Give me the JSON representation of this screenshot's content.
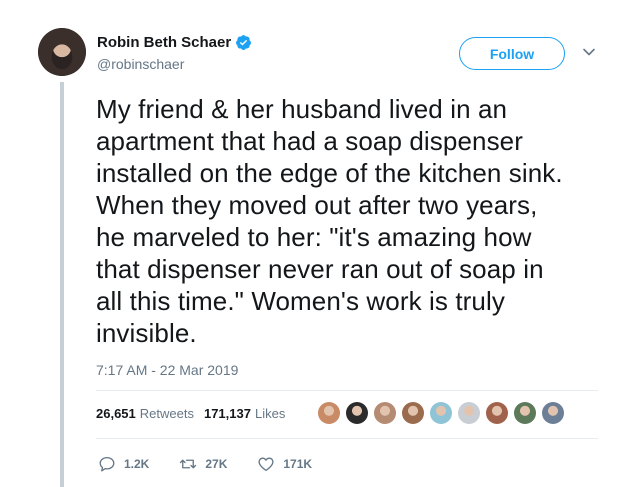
{
  "author": {
    "name": "Robin Beth Schaer",
    "handle": "@robinschaer",
    "verified_icon": "verified-badge-icon"
  },
  "follow_button": {
    "label": "Follow"
  },
  "tweet": {
    "text": "My friend & her husband lived in an\napartment that had a soap dispenser\ninstalled on the edge of the kitchen sink.\nWhen they moved out after two years,\nhe marveled to her: \"it's amazing how\nthat dispenser never ran out of soap in\nall this time.\" Women's work is truly\ninvisible.",
    "timestamp": "7:17 AM - 22 Mar 2019"
  },
  "stats": {
    "retweets_count": "26,651",
    "retweets_label": "Retweets",
    "likes_count": "171,137",
    "likes_label": "Likes"
  },
  "likers": [
    {
      "name": "liker-avatar-1",
      "color": "#c98a66"
    },
    {
      "name": "liker-avatar-2",
      "color": "#2b2b2b"
    },
    {
      "name": "liker-avatar-3",
      "color": "#b58b74"
    },
    {
      "name": "liker-avatar-4",
      "color": "#9b6b4d"
    },
    {
      "name": "liker-avatar-5",
      "color": "#8fc3d6"
    },
    {
      "name": "liker-avatar-6",
      "color": "#c8ced3"
    },
    {
      "name": "liker-avatar-7",
      "color": "#a0624a"
    },
    {
      "name": "liker-avatar-8",
      "color": "#5c7a5a"
    },
    {
      "name": "liker-avatar-9",
      "color": "#6c7f96"
    }
  ],
  "actions": {
    "reply_count": "1.2K",
    "retweet_count": "27K",
    "like_count": "171K"
  },
  "colors": {
    "accent": "#1da1f2",
    "text": "#14171a",
    "secondary": "#657786",
    "thread_line": "#c4cfd6"
  }
}
